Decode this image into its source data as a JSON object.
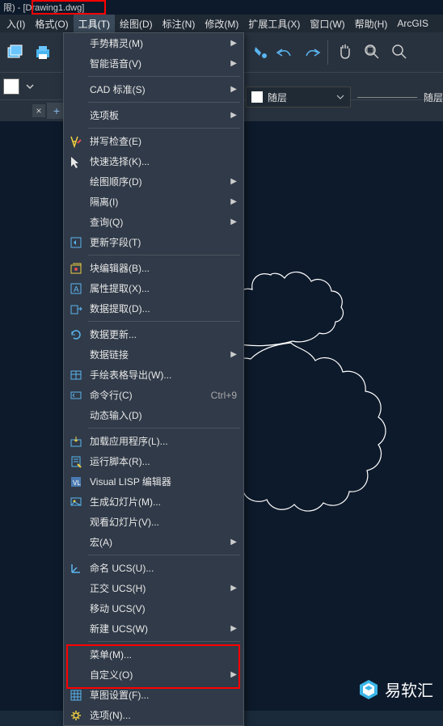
{
  "title": "限) - [Drawing1.dwg]",
  "menubar": [
    {
      "label": "入(I)"
    },
    {
      "label": "格式(O)"
    },
    {
      "label": "工具(T)",
      "active": true
    },
    {
      "label": "绘图(D)"
    },
    {
      "label": "标注(N)"
    },
    {
      "label": "修改(M)"
    },
    {
      "label": "扩展工具(X)"
    },
    {
      "label": "窗口(W)"
    },
    {
      "label": "帮助(H)"
    },
    {
      "label": "ArcGIS"
    }
  ],
  "layer": {
    "text": "随层",
    "text2": "随层"
  },
  "dropdown": {
    "items": [
      {
        "label": "手势精灵(M)",
        "arrow": true
      },
      {
        "label": "智能语音(V)",
        "arrow": true
      },
      {
        "type": "sep"
      },
      {
        "label": "CAD 标准(S)",
        "arrow": true
      },
      {
        "type": "sep"
      },
      {
        "label": "选项板",
        "arrow": true
      },
      {
        "type": "sep"
      },
      {
        "label": "拼写检查(E)",
        "icon": "spell"
      },
      {
        "label": "快速选择(K)...",
        "icon": "cursor"
      },
      {
        "label": "绘图顺序(D)",
        "arrow": true
      },
      {
        "label": "隔离(I)",
        "arrow": true
      },
      {
        "label": "查询(Q)",
        "arrow": true
      },
      {
        "label": "更新字段(T)",
        "icon": "update"
      },
      {
        "type": "sep"
      },
      {
        "label": "块编辑器(B)...",
        "icon": "block"
      },
      {
        "label": "属性提取(X)...",
        "icon": "attr"
      },
      {
        "label": "数据提取(D)...",
        "icon": "dataext"
      },
      {
        "type": "sep"
      },
      {
        "label": "数据更新...",
        "icon": "refresh"
      },
      {
        "label": "数据链接",
        "arrow": true
      },
      {
        "label": "手绘表格导出(W)...",
        "icon": "table"
      },
      {
        "label": "命令行(C)",
        "icon": "cmd",
        "shortcut": "Ctrl+9"
      },
      {
        "label": "动态输入(D)"
      },
      {
        "type": "sep"
      },
      {
        "label": "加载应用程序(L)...",
        "icon": "load"
      },
      {
        "label": "运行脚本(R)...",
        "icon": "script"
      },
      {
        "label": "Visual LISP 编辑器",
        "icon": "lisp"
      },
      {
        "label": "生成幻灯片(M)...",
        "icon": "slide"
      },
      {
        "label": "观看幻灯片(V)..."
      },
      {
        "label": "宏(A)",
        "arrow": true
      },
      {
        "type": "sep"
      },
      {
        "label": "命名 UCS(U)...",
        "icon": "ucs"
      },
      {
        "label": "正交 UCS(H)",
        "arrow": true
      },
      {
        "label": "移动 UCS(V)"
      },
      {
        "label": "新建 UCS(W)",
        "arrow": true
      },
      {
        "type": "sep"
      },
      {
        "label": "菜单(M)..."
      },
      {
        "label": "自定义(O)",
        "arrow": true
      },
      {
        "label": "草图设置(F)...",
        "icon": "grid"
      },
      {
        "label": "选项(N)...",
        "icon": "gear"
      }
    ]
  },
  "watermark": {
    "text": "易软汇"
  }
}
